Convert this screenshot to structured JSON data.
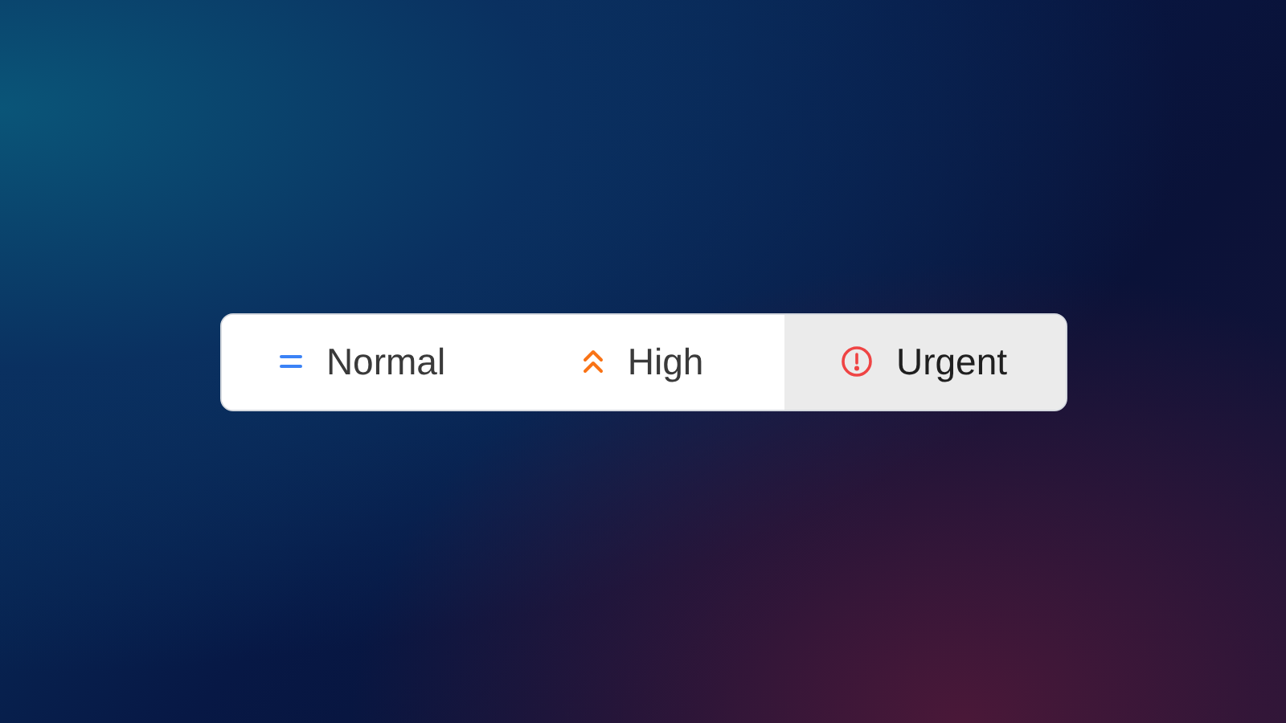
{
  "priority_selector": {
    "options": [
      {
        "label": "Normal",
        "kind": "normal",
        "color": "#3b82f6",
        "selected": false
      },
      {
        "label": "High",
        "kind": "high",
        "color": "#f97316",
        "selected": false
      },
      {
        "label": "Urgent",
        "kind": "urgent",
        "color": "#ef4444",
        "selected": true
      }
    ]
  }
}
